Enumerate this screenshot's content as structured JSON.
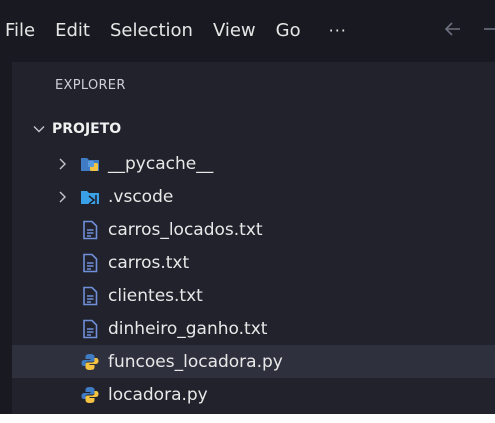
{
  "menubar": {
    "items": [
      "File",
      "Edit",
      "Selection",
      "View",
      "Go"
    ],
    "more": "···"
  },
  "explorer": {
    "title": "EXPLORER",
    "project": "PROJETO",
    "entries": [
      {
        "type": "folder",
        "name": "__pycache__",
        "icon": "python-folder-icon"
      },
      {
        "type": "folder",
        "name": ".vscode",
        "icon": "vscode-folder-icon"
      },
      {
        "type": "file",
        "name": "carros_locados.txt",
        "icon": "text-file-icon"
      },
      {
        "type": "file",
        "name": "carros.txt",
        "icon": "text-file-icon"
      },
      {
        "type": "file",
        "name": "clientes.txt",
        "icon": "text-file-icon"
      },
      {
        "type": "file",
        "name": "dinheiro_ganho.txt",
        "icon": "text-file-icon"
      },
      {
        "type": "file",
        "name": "funcoes_locadora.py",
        "icon": "python-file-icon",
        "selected": true
      },
      {
        "type": "file",
        "name": "locadora.py",
        "icon": "python-file-icon"
      }
    ]
  },
  "colors": {
    "background": "#21222c",
    "menubar": "#191a21",
    "selection": "#2f303d",
    "text_file_icon": "#6f8fd8",
    "python_blue": "#3f7cc4",
    "python_yellow": "#f5c242",
    "vscode_blue": "#3aa0e8"
  }
}
